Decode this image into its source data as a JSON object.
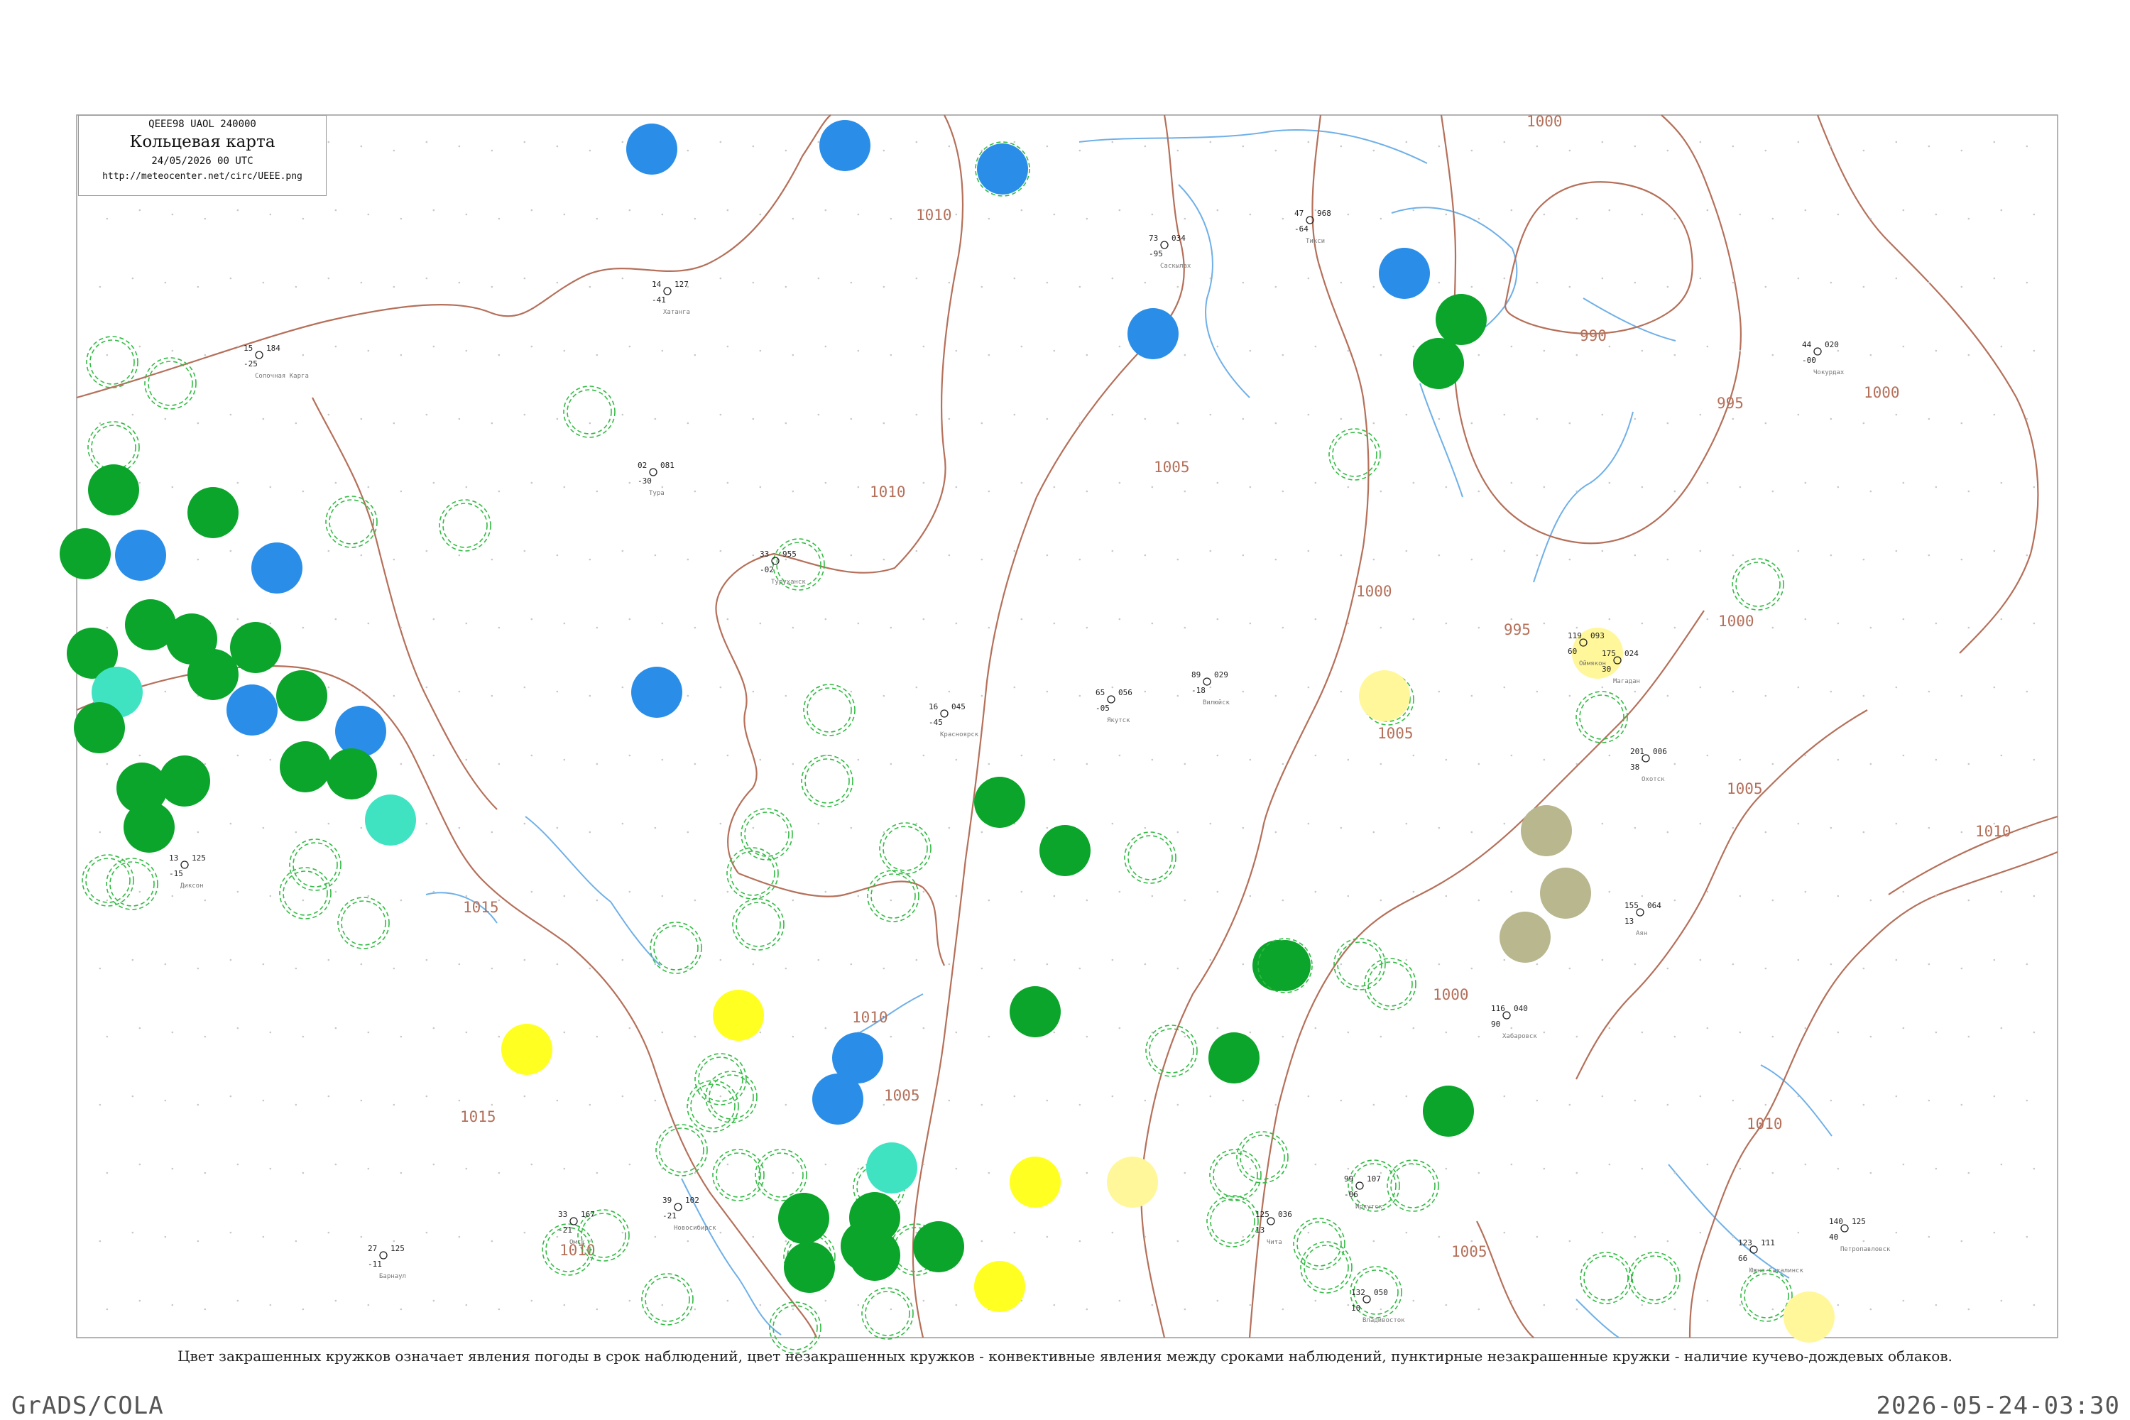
{
  "header": {
    "code": "QEEE98  UAOL  240000",
    "title": "Кольцевая карта",
    "datetime": "24/05/2026 00 UTC",
    "url": "http://meteocenter.net/circ/UEEE.png"
  },
  "caption": "Цвет закрашенных кружков означает явления погоды в срок наблюдений, цвет незакрашенных кружков - конвективные явления между сроками наблюдений, пунктирные незакрашенные кружки - наличие кучево-дождевых облаков.",
  "footer": {
    "left": "GrADS/COLA",
    "right": "2026-05-24-03:30"
  },
  "colors": {
    "isobar": "#b5705a",
    "river": "#6fb0e8",
    "frame": "#9a9a9a",
    "green": "#0aa52a",
    "blue": "#2a8ee8",
    "cyan": "#3fe3c2",
    "yellow": "#ffff22",
    "paleyellow": "#fff79a",
    "olive": "#b9b78e",
    "dash": "#33bb44"
  },
  "isobar_labels": [
    "1010",
    "1010",
    "1005",
    "1010",
    "1005",
    "1000",
    "995",
    "990",
    "995",
    "1000",
    "1000",
    "1000",
    "1005",
    "1010",
    "1015",
    "1015",
    "1010",
    "1010",
    "1005",
    "1000",
    "1005"
  ],
  "stations": [
    {
      "name": "Диксон",
      "t": "13",
      "td": "-15",
      "p": "125"
    },
    {
      "name": "Сопочная Карга",
      "t": "15",
      "td": "-25",
      "p": "184"
    },
    {
      "name": "Хатанга",
      "t": "14",
      "td": "-41",
      "p": "127"
    },
    {
      "name": "Саскылах",
      "t": "73",
      "td": "-95",
      "p": "034"
    },
    {
      "name": "Тикси",
      "t": "47",
      "td": "-64",
      "p": "968"
    },
    {
      "name": "Чокурдах",
      "t": "44",
      "td": "-00",
      "p": "020"
    },
    {
      "name": "Туруханск",
      "t": "33",
      "td": "-02",
      "p": "955"
    },
    {
      "name": "Тура",
      "t": "02",
      "td": "-30",
      "p": "081"
    },
    {
      "name": "Вилюйск",
      "t": "89",
      "td": "-18",
      "p": "029"
    },
    {
      "name": "Якутск",
      "t": "65",
      "td": "-05",
      "p": "056"
    },
    {
      "name": "Оймякон",
      "t": "119",
      "td": "60",
      "p": "093"
    },
    {
      "name": "Магадан",
      "t": "175",
      "td": "30",
      "p": "024"
    },
    {
      "name": "Охотск",
      "t": "201",
      "td": "38",
      "p": "006"
    },
    {
      "name": "Аян",
      "t": "155",
      "td": "13",
      "p": "064"
    },
    {
      "name": "Хабаровск",
      "t": "116",
      "td": "90",
      "p": "040"
    },
    {
      "name": "Владивосток",
      "t": "132",
      "td": "10",
      "p": "050"
    },
    {
      "name": "Южно-Сахалинск",
      "t": "123",
      "td": "66",
      "p": "111"
    },
    {
      "name": "Петропавловск",
      "t": "140",
      "td": "40",
      "p": "125"
    },
    {
      "name": "Иркутск",
      "t": "99",
      "td": "-06",
      "p": "107"
    },
    {
      "name": "Чита",
      "t": "125",
      "td": "13",
      "p": "036"
    },
    {
      "name": "Новосибирск",
      "t": "39",
      "td": "-21",
      "p": "102"
    },
    {
      "name": "Омск",
      "t": "33",
      "td": "-21",
      "p": "167"
    },
    {
      "name": "Барнаул",
      "t": "27",
      "td": "-11",
      "p": "125"
    },
    {
      "name": "Красноярск",
      "t": "16",
      "td": "-45",
      "p": "045"
    }
  ]
}
